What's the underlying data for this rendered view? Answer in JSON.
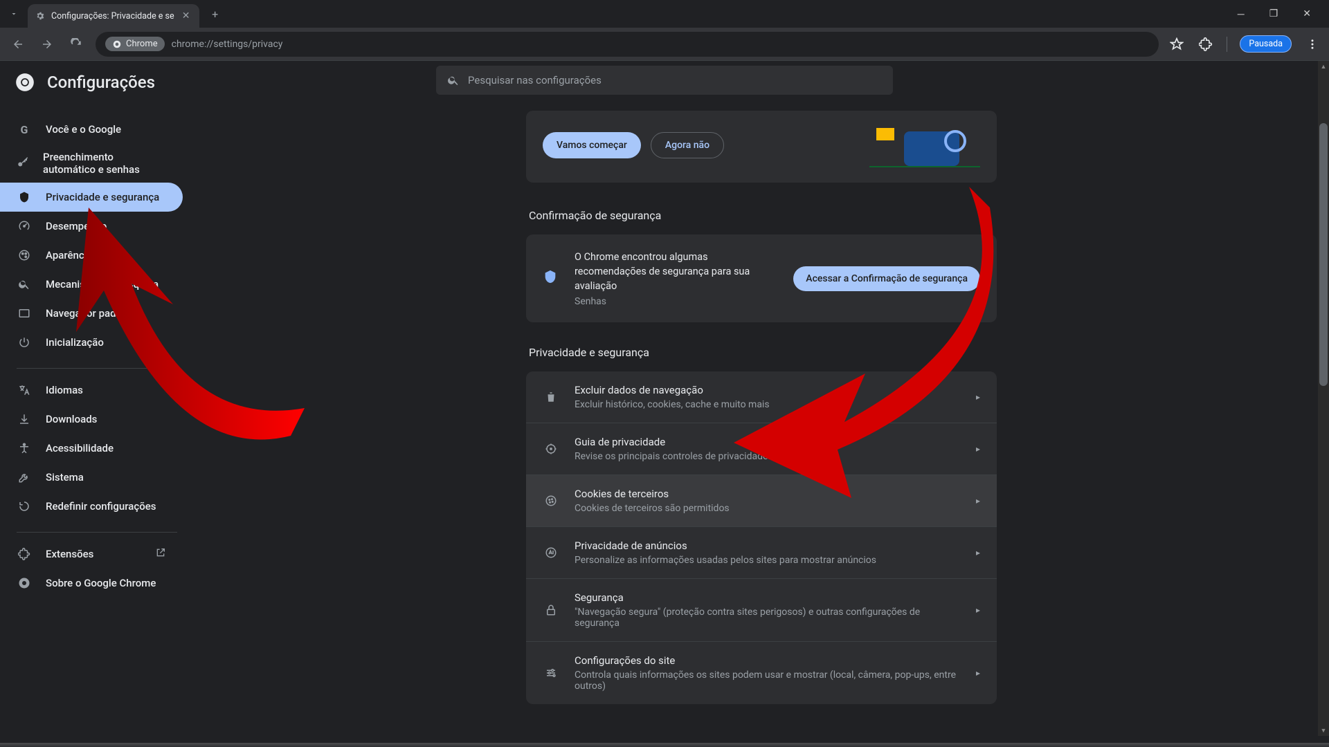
{
  "window": {
    "tab_title": "Configurações: Privacidade e se"
  },
  "toolbar": {
    "chrome_chip": "Chrome",
    "url": "chrome://settings/privacy",
    "profile_status": "Pausada"
  },
  "settings_header": {
    "title": "Configurações"
  },
  "search": {
    "placeholder": "Pesquisar nas configurações"
  },
  "sidebar": {
    "items": [
      {
        "icon": "G",
        "label": "Você e o Google"
      },
      {
        "icon": "key",
        "label": "Preenchimento automático e senhas"
      },
      {
        "icon": "shield",
        "label": "Privacidade e segurança",
        "active": true
      },
      {
        "icon": "speed",
        "label": "Desempenho"
      },
      {
        "icon": "brush",
        "label": "Aparência"
      },
      {
        "icon": "search",
        "label": "Mecanismo de pesquisa"
      },
      {
        "icon": "rect",
        "label": "Navegador padrão"
      },
      {
        "icon": "power",
        "label": "Inicialização"
      }
    ],
    "items2": [
      {
        "icon": "lang",
        "label": "Idiomas"
      },
      {
        "icon": "download",
        "label": "Downloads"
      },
      {
        "icon": "access",
        "label": "Acessibilidade"
      },
      {
        "icon": "wrench",
        "label": "Sistema"
      },
      {
        "icon": "reset",
        "label": "Redefinir configurações"
      }
    ],
    "items3": [
      {
        "icon": "ext",
        "label": "Extensões",
        "external": true
      },
      {
        "icon": "chrome",
        "label": "Sobre o Google Chrome"
      }
    ]
  },
  "promo": {
    "primary": "Vamos começar",
    "secondary": "Agora não"
  },
  "safety": {
    "section_title": "Confirmação de segurança",
    "line1": "O Chrome encontrou algumas recomendações de segurança para sua avaliação",
    "line2": "Senhas",
    "button": "Acessar a Confirmação de segurança"
  },
  "privacy": {
    "section_title": "Privacidade e segurança",
    "rows": [
      {
        "icon": "trash",
        "title": "Excluir dados de navegação",
        "sub": "Excluir histórico, cookies, cache e muito mais"
      },
      {
        "icon": "target",
        "title": "Guia de privacidade",
        "sub": "Revise os principais controles de privacidade e segurança"
      },
      {
        "icon": "cookie",
        "title": "Cookies de terceiros",
        "sub": "Cookies de terceiros são permitidos",
        "hover": true
      },
      {
        "icon": "ad",
        "title": "Privacidade de anúncios",
        "sub": "Personalize as informações usadas pelos sites para mostrar anúncios"
      },
      {
        "icon": "lock",
        "title": "Segurança",
        "sub": "\"Navegação segura\" (proteção contra sites perigosos) e outras configurações de segurança"
      },
      {
        "icon": "tune",
        "title": "Configurações do site",
        "sub": "Controla quais informações os sites podem usar e mostrar (local, câmera, pop-ups, entre outros)"
      }
    ]
  }
}
